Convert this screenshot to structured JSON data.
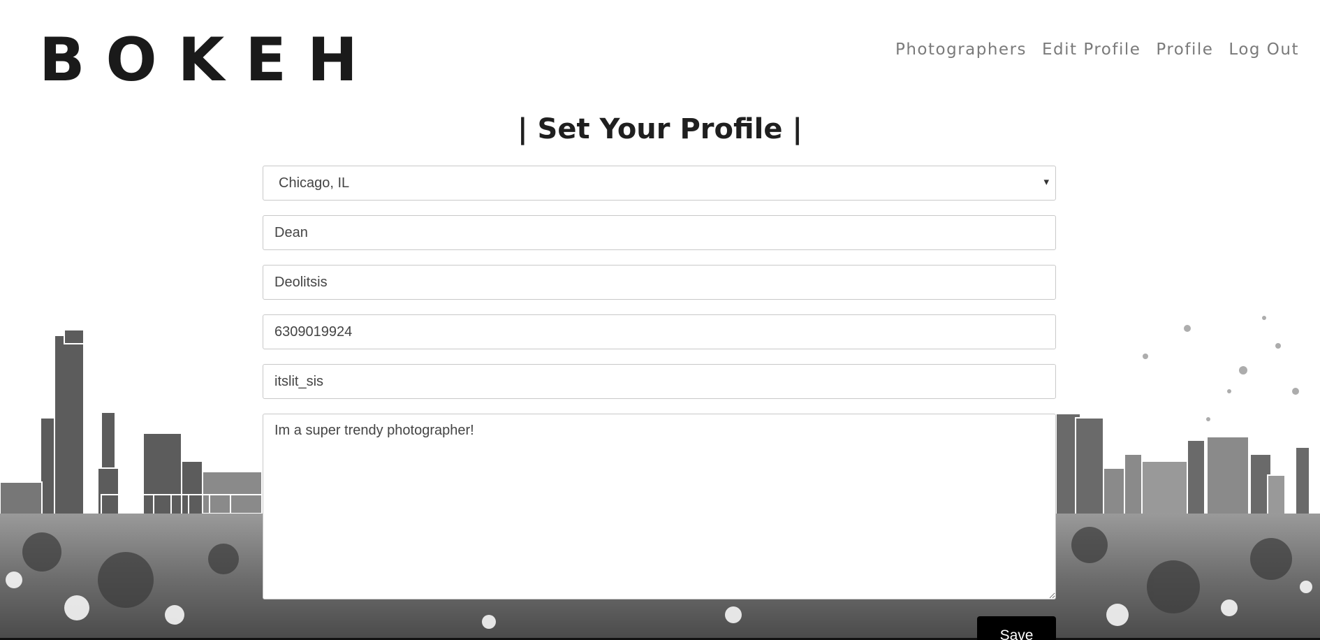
{
  "brand": {
    "logo_text": "BOKEH"
  },
  "nav": {
    "items": [
      {
        "label": "Photographers"
      },
      {
        "label": "Edit Profile"
      },
      {
        "label": "Profile"
      },
      {
        "label": "Log Out"
      }
    ]
  },
  "page": {
    "title": "| Set Your Profile |"
  },
  "form": {
    "city": {
      "selected": "Chicago, IL"
    },
    "first_name": {
      "value": "Dean"
    },
    "last_name": {
      "value": "Deolitsis"
    },
    "phone": {
      "value": "6309019924"
    },
    "instagram": {
      "value": "itslit_sis"
    },
    "bio": {
      "value": "Im a super trendy photographer!"
    },
    "save_label": "Save"
  },
  "icons": {
    "select_arrow": "chevron-down-icon"
  },
  "colors": {
    "logo": "#1a1a1a",
    "nav_text": "#7a7a7a",
    "button_bg": "#000000",
    "button_text": "#ffffff"
  }
}
